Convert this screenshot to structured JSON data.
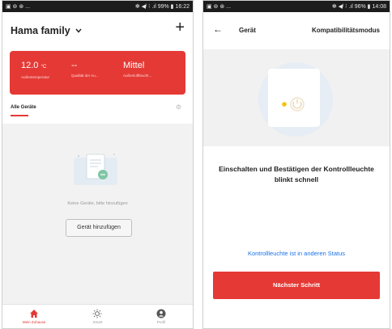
{
  "left_phone": {
    "status": {
      "left": "▣ ⊚ ⊛ ...",
      "right": "✻ ◀ᴵ ⁝ .ıl 99% ▮ 16:22"
    },
    "home_title": "Hama family",
    "weather": [
      {
        "value": "12.0",
        "unit": "°C",
        "label": "Außentemperatur"
      },
      {
        "value": "--",
        "unit": "",
        "label": "Qualität der Au..."
      },
      {
        "value": "Mittel",
        "unit": "",
        "label": "Außenluftfeucht..."
      }
    ],
    "tab_all": "Alle Geräte",
    "empty_text": "Keine Geräte, bitte hinzufügen",
    "add_device": "Gerät hinzufügen",
    "nav": [
      {
        "label": "Mein Zuhause",
        "icon": "home-icon",
        "active": true
      },
      {
        "label": "Smart",
        "icon": "sun-icon",
        "active": false
      },
      {
        "label": "Profil",
        "icon": "profile-icon",
        "active": false
      }
    ],
    "colors": {
      "accent": "#e53935"
    }
  },
  "right_phone": {
    "status": {
      "left": "▣ ⊚ ⊛ ...",
      "right": "✻ ◀ᴵ ⁝ .ıl 96% ▮ 14:08"
    },
    "title": "Gerät",
    "compat": "Kompatibilitätsmodus",
    "instruction": "Einschalten und Bestätigen der Kontrollleuchte blinkt schnell",
    "link": "Kontrollleuchte ist in anderen Status",
    "next": "Nächster Schritt",
    "colors": {
      "accent": "#e53935",
      "link": "#1a73e8",
      "led": "#f4c20d"
    }
  }
}
